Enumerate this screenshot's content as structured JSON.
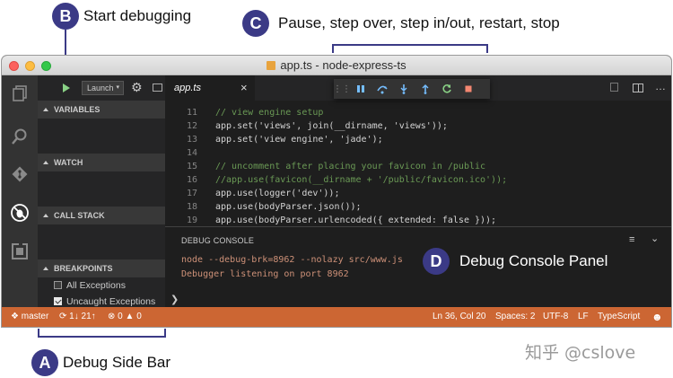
{
  "callouts": {
    "b": {
      "letter": "B",
      "text": "Start debugging"
    },
    "c": {
      "letter": "C",
      "text": "Pause, step over, step in/out, restart, stop"
    },
    "d": {
      "letter": "D",
      "text": "Debug Console Panel"
    },
    "a": {
      "letter": "A",
      "text": "Debug Side Bar"
    }
  },
  "window": {
    "title": "app.ts - node-express-ts"
  },
  "sidebar": {
    "config": "Launch",
    "sections": {
      "variables": "VARIABLES",
      "watch": "WATCH",
      "call_stack": "CALL STACK",
      "breakpoints": "BREAKPOINTS"
    },
    "breakpoints": [
      {
        "label": "All Exceptions",
        "checked": false
      },
      {
        "label": "Uncaught Exceptions",
        "checked": true
      }
    ]
  },
  "tabs": [
    {
      "label": "app.ts",
      "close": "×"
    }
  ],
  "editor": {
    "lines": [
      {
        "n": "11",
        "text": "// view engine setup"
      },
      {
        "n": "12",
        "text": "app.set('views', join(__dirname, 'views'));"
      },
      {
        "n": "13",
        "text": "app.set('view engine', 'jade');"
      },
      {
        "n": "14",
        "text": ""
      },
      {
        "n": "15",
        "text": "// uncomment after placing your favicon in /public"
      },
      {
        "n": "16",
        "text": "//app.use(favicon(__dirname + '/public/favicon.ico'));"
      },
      {
        "n": "17",
        "text": "app.use(logger('dev'));"
      },
      {
        "n": "18",
        "text": "app.use(bodyParser.json());"
      },
      {
        "n": "19",
        "text": "app.use(bodyParser.urlencoded({ extended: false }));"
      }
    ]
  },
  "panel": {
    "title": "DEBUG CONSOLE",
    "lines": [
      "node --debug-brk=8962 --nolazy src/www.js",
      "Debugger listening on port 8962"
    ],
    "prompt": "❯"
  },
  "status": {
    "branch": "master",
    "sync": "1↓ 21↑",
    "errors": "0",
    "warnings": "0",
    "position": "Ln 36, Col 20",
    "spaces": "Spaces: 2",
    "encoding": "UTF-8",
    "eol": "LF",
    "language": "TypeScript"
  },
  "watermark": "知乎 @cslove",
  "colors": {
    "accent": "#3b3a86",
    "statusbar": "#cc6633",
    "comment": "#6a9955",
    "string": "#ce9178"
  }
}
